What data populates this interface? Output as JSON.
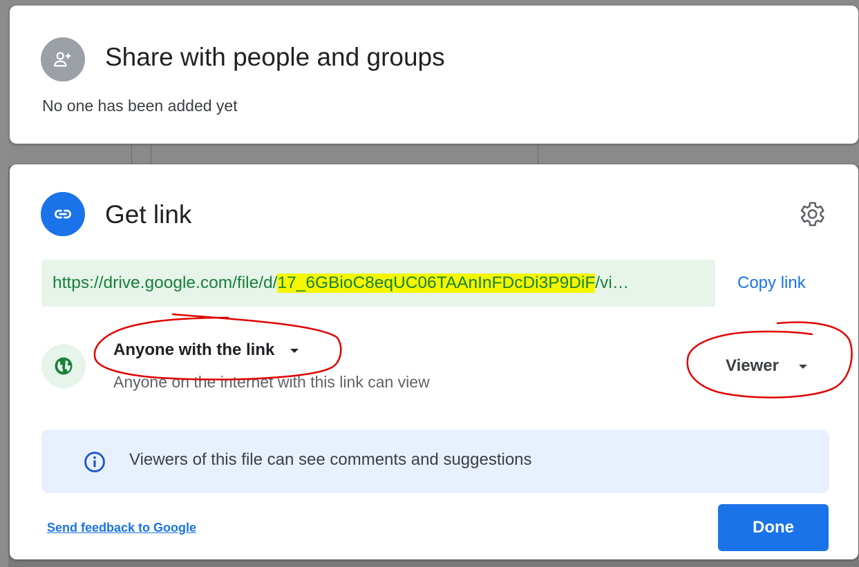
{
  "share": {
    "title": "Share with people and groups",
    "empty_text": "No one has been added yet",
    "icon": "add-person-icon"
  },
  "link": {
    "title": "Get link",
    "icon": "link-icon",
    "settings_icon": "gear-icon",
    "url_prefix": "https://drive.google.com/file/d/",
    "url_id": "17_6GBioC8eqUC06TAAnInFDcDi3P9DiF",
    "url_suffix": "/vi…",
    "copy_label": "Copy link",
    "access_scope": "Anyone with the link",
    "access_description": "Anyone on the internet with this link can view",
    "role": "Viewer",
    "info_text": "Viewers of this file can see comments and suggestions",
    "feedback_label": "Send feedback to Google",
    "done_label": "Done"
  },
  "colors": {
    "accent": "#1a73e8",
    "url_text": "#188038",
    "url_bg": "#e6f4ea",
    "highlight": "#f4f700",
    "annotation": "#e00000"
  }
}
